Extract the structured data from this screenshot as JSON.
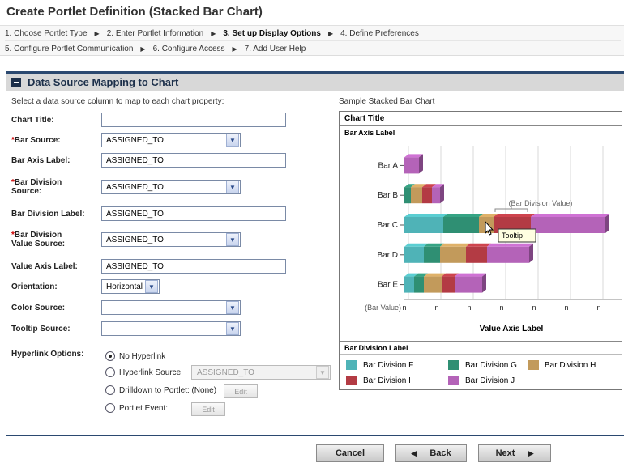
{
  "page_title": "Create Portlet Definition (Stacked Bar Chart)",
  "steps": {
    "row1": [
      {
        "label": "1. Choose Portlet Type",
        "active": false
      },
      {
        "label": "2. Enter Portlet Information",
        "active": false
      },
      {
        "label": "3. Set up Display Options",
        "active": true
      },
      {
        "label": "4. Define Preferences",
        "active": false
      }
    ],
    "row2": [
      {
        "label": "5. Configure Portlet Communication",
        "active": false
      },
      {
        "label": "6. Configure Access",
        "active": false
      },
      {
        "label": "7. Add User Help",
        "active": false
      }
    ]
  },
  "section": {
    "title": "Data Source Mapping to Chart",
    "instruction": "Select a data source column to map to each chart property:"
  },
  "form": {
    "chart_title": {
      "label": "Chart Title:",
      "value": ""
    },
    "bar_source": {
      "label": "Bar Source:",
      "value": "ASSIGNED_TO",
      "required": true
    },
    "bar_axis_label": {
      "label": "Bar Axis Label:",
      "value": "ASSIGNED_TO"
    },
    "bar_division_source": {
      "label_line1": "Bar Division",
      "label_line2": "Source:",
      "value": "ASSIGNED_TO",
      "required": true
    },
    "bar_division_label": {
      "label": "Bar Division Label:",
      "value": "ASSIGNED_TO"
    },
    "bar_division_value_source": {
      "label_line1": "Bar Division",
      "label_line2": "Value Source:",
      "value": "ASSIGNED_TO",
      "required": true
    },
    "value_axis_label": {
      "label": "Value Axis Label:",
      "value": "ASSIGNED_TO"
    },
    "orientation": {
      "label": "Orientation:",
      "value": "Horizontal"
    },
    "color_source": {
      "label": "Color Source:",
      "value": ""
    },
    "tooltip_source": {
      "label": "Tooltip Source:",
      "value": ""
    },
    "hyperlink": {
      "label": "Hyperlink Options:",
      "options": [
        {
          "label": "No Hyperlink",
          "checked": true
        },
        {
          "label": "Hyperlink Source:",
          "checked": false
        },
        {
          "label": "Drilldown to Portlet: (None)",
          "checked": false
        },
        {
          "label": "Portlet Event:",
          "checked": false
        }
      ],
      "hyperlink_source_value": "ASSIGNED_TO",
      "edit_label": "Edit"
    }
  },
  "preview": {
    "caption": "Sample Stacked Bar Chart"
  },
  "chart_data": {
    "type": "bar",
    "orientation": "horizontal",
    "stacked": true,
    "title": "Chart Title",
    "bar_axis_label": "Bar Axis Label",
    "value_axis_label": "Value Axis Label",
    "value_tick_prefix": "(Bar Value)",
    "value_tick_labels": [
      "n",
      "n",
      "n",
      "n",
      "n",
      "n",
      "n",
      "n"
    ],
    "categories": [
      "Bar A",
      "Bar B",
      "Bar C",
      "Bar D",
      "Bar E"
    ],
    "legend_title": "Bar Division Label",
    "series": [
      {
        "name": "Bar Division F",
        "color": "#4fb3b7",
        "values": [
          0,
          0,
          1.2,
          0.6,
          0.3
        ]
      },
      {
        "name": "Bar Division G",
        "color": "#2f8f73",
        "values": [
          0,
          0.2,
          1.1,
          0.5,
          0.3
        ]
      },
      {
        "name": "Bar Division H",
        "color": "#c29a5b",
        "values": [
          0,
          0.35,
          0.45,
          0.8,
          0.55
        ]
      },
      {
        "name": "Bar Division I",
        "color": "#b33b44",
        "values": [
          0,
          0.3,
          1.15,
          0.65,
          0.4
        ]
      },
      {
        "name": "Bar Division J",
        "color": "#b463b8",
        "values": [
          0.45,
          0.25,
          2.3,
          1.3,
          0.85
        ]
      }
    ],
    "annotations": {
      "division_value": "(Bar Division Value)",
      "tooltip": "Tooltip"
    },
    "grid": true,
    "legend_position": "bottom"
  },
  "buttons": {
    "cancel": "Cancel",
    "back": "Back",
    "next": "Next"
  }
}
